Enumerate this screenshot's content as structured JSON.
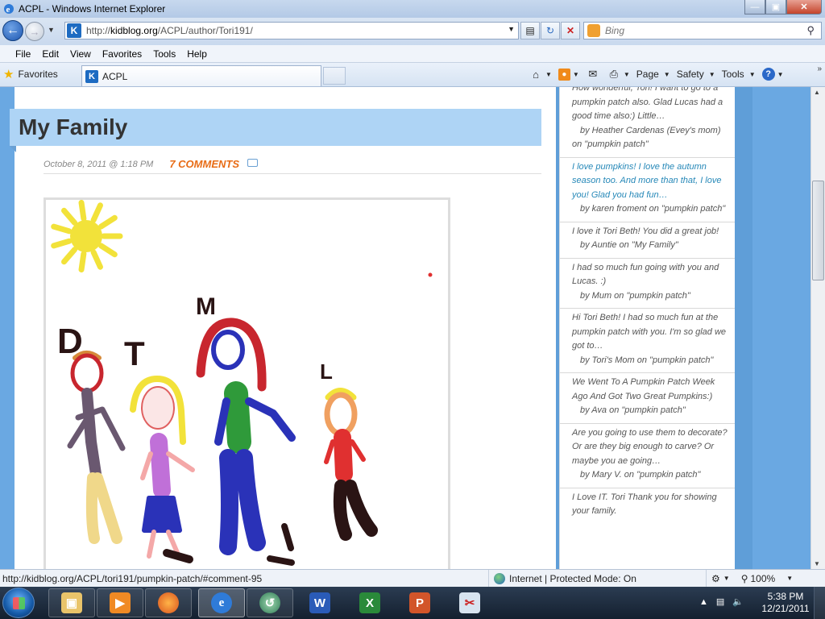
{
  "window": {
    "title": "ACPL - Windows Internet Explorer"
  },
  "address": {
    "url_prefix": "http://",
    "url_host": "kidblog.org",
    "url_path": "/ACPL/author/Tori191/"
  },
  "search": {
    "placeholder": "Bing"
  },
  "menu": [
    "File",
    "Edit",
    "View",
    "Favorites",
    "Tools",
    "Help"
  ],
  "favorites": {
    "label": "Favorites"
  },
  "tab": {
    "label": "ACPL"
  },
  "commandbar": {
    "page": "Page",
    "safety": "Safety",
    "tools": "Tools"
  },
  "post": {
    "title": "My Family",
    "date": "October 8, 2011 @ 1:18 PM",
    "comments": "7 COMMENTS"
  },
  "drawing": {
    "letters": [
      "D",
      "T",
      "M",
      "L"
    ],
    "colors": {
      "sun": "#f2e23a",
      "hair_red": "#c8262e",
      "shirt_green": "#2f9a3a",
      "pants_blue": "#2a32b8",
      "dress_purple": "#c070d8",
      "body_red": "#e03030",
      "outline": "#2a1414"
    }
  },
  "sidebar": {
    "comments": [
      {
        "text": "How wonderful, Tori! I want to go to a pumpkin patch also. Glad Lucas had a good time also:) Little…",
        "byline": "by Heather Cardenas (Evey's mom)",
        "on": "on \"pumpkin patch\"",
        "link": false
      },
      {
        "text": "I love pumpkins! I love the autumn season too. And more than that, I love you! Glad you had fun…",
        "byline": "by karen froment on \"pumpkin patch\"",
        "on": "",
        "link": true
      },
      {
        "text": "I love it Tori Beth! You did a great job!",
        "byline": "by Auntie on \"My Family\"",
        "on": "",
        "link": false
      },
      {
        "text": "I had so much fun going with you and Lucas. :)",
        "byline": "by Mum on \"pumpkin patch\"",
        "on": "",
        "link": false
      },
      {
        "text": "Hi Tori Beth! I had so much fun at the pumpkin patch with you. I'm so glad we got to…",
        "byline": "by Tori's Mom on \"pumpkin patch\"",
        "on": "",
        "link": false
      },
      {
        "text": "We Went To A Pumpkin Patch Week Ago And Got Two Great Pumpkins:)",
        "byline": "by Ava on \"pumpkin patch\"",
        "on": "",
        "link": false
      },
      {
        "text": "Are you going to use them to decorate? Or are they big enough to carve? Or maybe you ae going…",
        "byline": "by Mary V. on \"pumpkin patch\"",
        "on": "",
        "link": false
      },
      {
        "text": "I Love IT. Tori Thank you for showing your family.",
        "byline": "",
        "on": "",
        "link": false
      }
    ]
  },
  "status": {
    "url": "http://kidblog.org/ACPL/tori191/pumpkin-patch/#comment-95",
    "zone": "Internet | Protected Mode: On",
    "zoom": "100%"
  },
  "clock": {
    "time": "5:38 PM",
    "date": "12/21/2011"
  },
  "colors": {
    "accent_orange": "#e86c16",
    "title_bar_blue": "#aed4f5",
    "page_blue": "#6aa8e2",
    "link_blue": "#2688b8"
  }
}
